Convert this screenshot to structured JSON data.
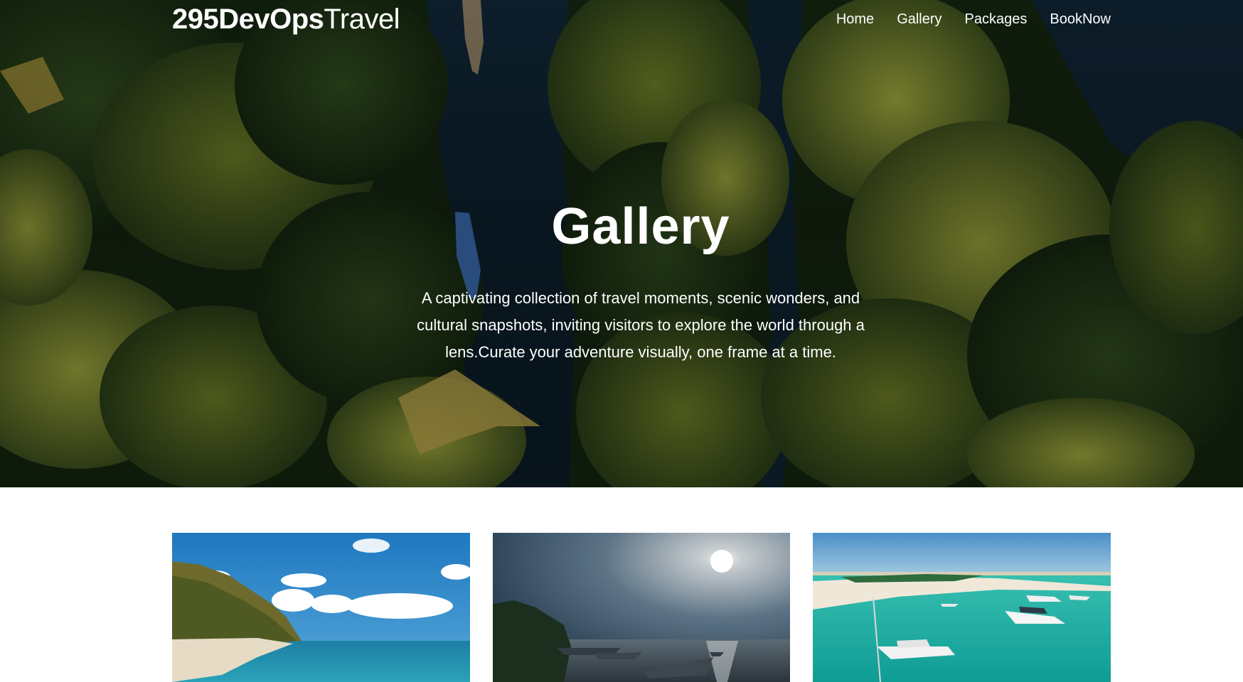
{
  "brand": {
    "bold": "295DevOps",
    "light": "Travel"
  },
  "nav": {
    "items": [
      {
        "label": "Home"
      },
      {
        "label": "Gallery"
      },
      {
        "label": "Packages"
      },
      {
        "label": "BookNow"
      }
    ]
  },
  "hero": {
    "title": "Gallery",
    "description": "A captivating collection of travel moments, scenic wonders, and cultural snapshots, inviting visitors to explore the world through a lens.Curate your adventure visually, one frame at a time."
  },
  "colors": {
    "nav_text": "#ffffff",
    "page_background": "#ffffff"
  }
}
